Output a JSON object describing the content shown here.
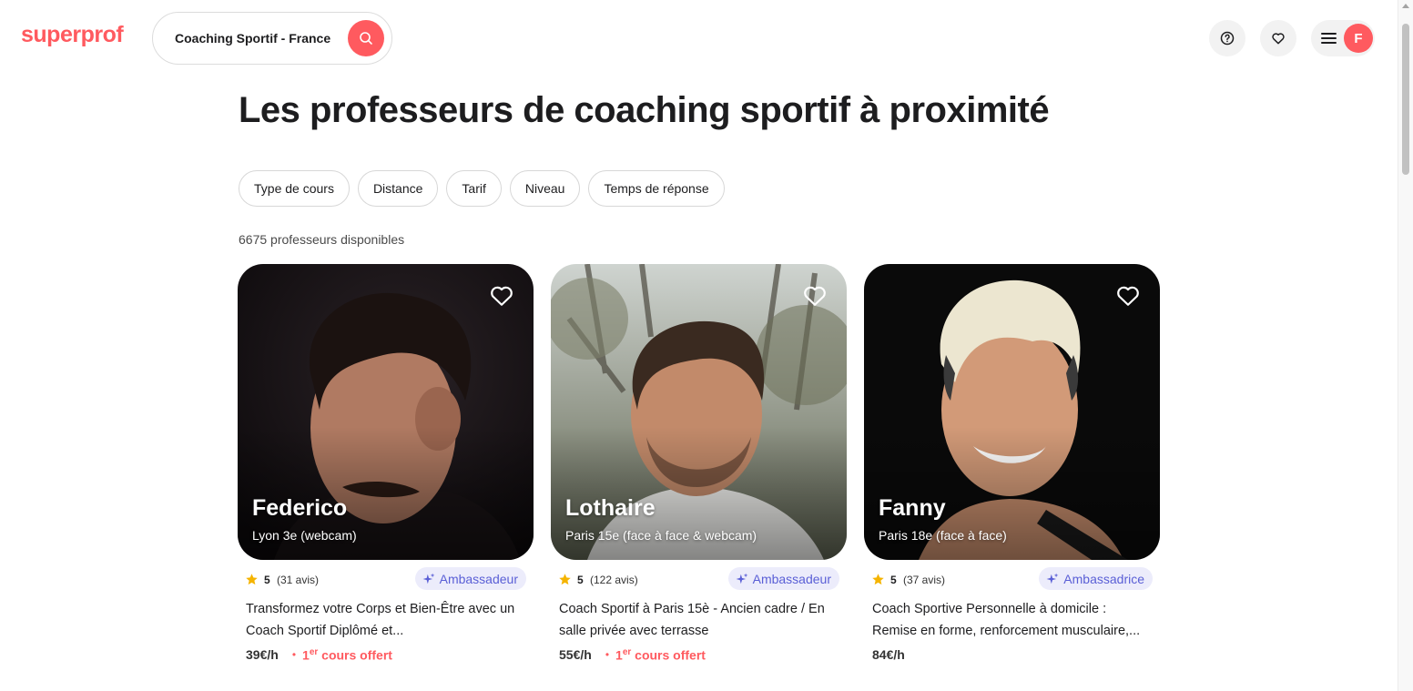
{
  "header": {
    "logo": "superprof",
    "search_value": "Coaching Sportif - France",
    "avatar_initial": "F"
  },
  "page": {
    "title": "Les professeurs de coaching sportif à proximité",
    "results_count": "6675 professeurs disponibles"
  },
  "filters": [
    "Type de cours",
    "Distance",
    "Tarif",
    "Niveau",
    "Temps de réponse"
  ],
  "colors": {
    "brand": "#ff5a5f",
    "badge_bg": "#ececfb",
    "badge_text": "#5a5fd6",
    "star": "#f5b400"
  },
  "teachers": [
    {
      "name": "Federico",
      "location": "Lyon 3e (webcam)",
      "rating": "5",
      "reviews": "(31 avis)",
      "badge": "Ambassadeur",
      "description": "Transformez votre Corps et Bien-Être avec un Coach Sportif Diplômé et...",
      "price": "39€/h",
      "offer_prefix": "1",
      "offer_sup": "er",
      "offer_text": " cours offert"
    },
    {
      "name": "Lothaire",
      "location": "Paris 15e (face à face & webcam)",
      "rating": "5",
      "reviews": "(122 avis)",
      "badge": "Ambassadeur",
      "description": "Coach Sportif à Paris 15è - Ancien cadre / En salle privée avec terrasse",
      "price": "55€/h",
      "offer_prefix": "1",
      "offer_sup": "er",
      "offer_text": " cours offert"
    },
    {
      "name": "Fanny",
      "location": "Paris 18e (face à face)",
      "rating": "5",
      "reviews": "(37 avis)",
      "badge": "Ambassadrice",
      "description": "Coach Sportive Personnelle à domicile : Remise en forme, renforcement musculaire,...",
      "price": "84€/h"
    }
  ]
}
